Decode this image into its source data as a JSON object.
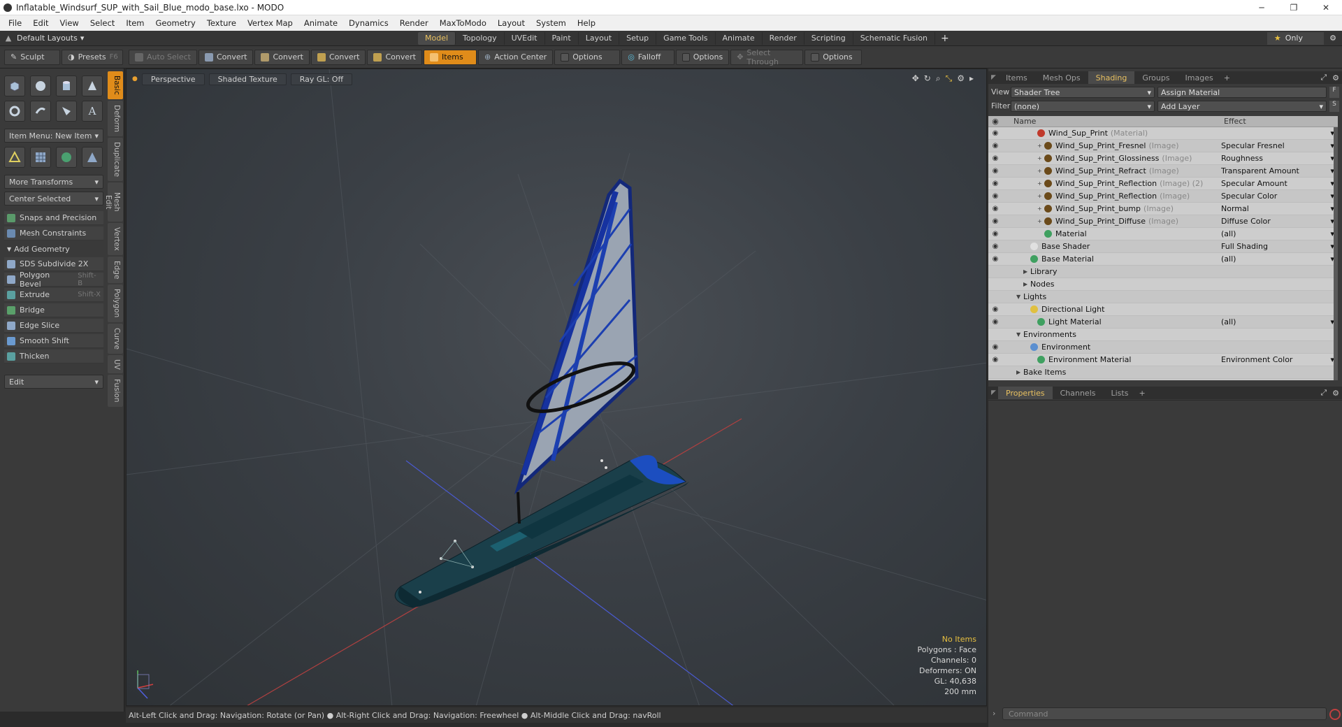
{
  "window": {
    "title": "Inflatable_Windsurf_SUP_with_Sail_Blue_modo_base.lxo - MODO"
  },
  "menu": [
    "File",
    "Edit",
    "View",
    "Select",
    "Item",
    "Geometry",
    "Texture",
    "Vertex Map",
    "Animate",
    "Dynamics",
    "Render",
    "MaxToModo",
    "Layout",
    "System",
    "Help"
  ],
  "layouts": {
    "preset": "Default Layouts",
    "tabs": [
      "Model",
      "Topology",
      "UVEdit",
      "Paint",
      "Layout",
      "Setup",
      "Game Tools",
      "Animate",
      "Render",
      "Scripting",
      "Schematic Fusion"
    ],
    "active": "Model",
    "only_label": "Only"
  },
  "toolbar": {
    "sculpt": "Sculpt",
    "presets": "Presets",
    "presets_key": "F6",
    "auto_select": "Auto Select",
    "convert1": "Convert",
    "convert2": "Convert",
    "convert3": "Convert",
    "convert4": "Convert",
    "items": "Items",
    "action_center": "Action Center",
    "options1": "Options",
    "falloff": "Falloff",
    "options2": "Options",
    "select_through": "Select Through",
    "options3": "Options"
  },
  "left": {
    "item_menu": "Item Menu: New Item",
    "more_transforms": "More Transforms",
    "center_selected": "Center Selected",
    "snaps": "Snaps and Precision",
    "mesh_constraints": "Mesh Constraints",
    "add_geometry": "Add Geometry",
    "tools": [
      {
        "label": "SDS Subdivide 2X",
        "key": ""
      },
      {
        "label": "Polygon Bevel",
        "key": "Shift-B"
      },
      {
        "label": "Extrude",
        "key": "Shift-X"
      },
      {
        "label": "Bridge",
        "key": ""
      },
      {
        "label": "Edge Slice",
        "key": ""
      },
      {
        "label": "Smooth Shift",
        "key": ""
      },
      {
        "label": "Thicken",
        "key": ""
      }
    ],
    "edit": "Edit",
    "vtabs": [
      "Basic",
      "Deform",
      "Duplicate",
      "Mesh Edit",
      "Vertex",
      "Edge",
      "Polygon",
      "Curve",
      "UV",
      "Fusion"
    ]
  },
  "viewport": {
    "perspective": "Perspective",
    "shading": "Shaded Texture",
    "raygl": "Ray GL: Off",
    "info": {
      "items": "No Items",
      "polygons": "Polygons : Face",
      "channels": "Channels: 0",
      "deformers": "Deformers: ON",
      "gl": "GL: 40,638",
      "scale": "200 mm"
    }
  },
  "status": "Alt-Left Click and Drag: Navigation: Rotate (or Pan) ●  Alt-Right Click and Drag: Navigation: Freewheel ●  Alt-Middle Click and Drag: navRoll",
  "right": {
    "tabs": [
      "Items",
      "Mesh Ops",
      "Shading",
      "Groups",
      "Images"
    ],
    "active_tab": "Shading",
    "view_label": "View",
    "view_value": "Shader Tree",
    "assign_material": "Assign Material",
    "filter_label": "Filter",
    "filter_value": "(none)",
    "add_layer": "Add Layer",
    "col_name": "Name",
    "col_effect": "Effect",
    "rows": [
      {
        "name": "Wind_Sup_Print",
        "type": "(Material)",
        "effect": "",
        "indent": 4,
        "ball": "#c0392b"
      },
      {
        "name": "Wind_Sup_Print_Fresnel",
        "type": "(Image)",
        "effect": "Specular Fresnel",
        "indent": 5,
        "ball": "#6b4a1a"
      },
      {
        "name": "Wind_Sup_Print_Glossiness",
        "type": "(Image)",
        "effect": "Roughness",
        "indent": 5,
        "ball": "#6b4a1a"
      },
      {
        "name": "Wind_Sup_Print_Refract",
        "type": "(Image)",
        "effect": "Transparent Amount",
        "indent": 5,
        "ball": "#6b4a1a"
      },
      {
        "name": "Wind_Sup_Print_Reflection",
        "type": "(Image) (2)",
        "effect": "Specular Amount",
        "indent": 5,
        "ball": "#6b4a1a"
      },
      {
        "name": "Wind_Sup_Print_Reflection",
        "type": "(Image)",
        "effect": "Specular Color",
        "indent": 5,
        "ball": "#6b4a1a"
      },
      {
        "name": "Wind_Sup_Print_bump",
        "type": "(Image)",
        "effect": "Normal",
        "indent": 5,
        "ball": "#6b4a1a"
      },
      {
        "name": "Wind_Sup_Print_Diffuse",
        "type": "(Image)",
        "effect": "Diffuse Color",
        "indent": 5,
        "ball": "#6b4a1a"
      },
      {
        "name": "Material",
        "type": "",
        "effect": "(all)",
        "indent": 5,
        "ball": "#3fa060"
      },
      {
        "name": "Base Shader",
        "type": "",
        "effect": "Full Shading",
        "indent": 3,
        "ball": "#e0e0e0"
      },
      {
        "name": "Base Material",
        "type": "",
        "effect": "(all)",
        "indent": 3,
        "ball": "#3fa060"
      },
      {
        "name": "Library",
        "type": "",
        "effect": "",
        "indent": 3,
        "ball": ""
      },
      {
        "name": "Nodes",
        "type": "",
        "effect": "",
        "indent": 3,
        "ball": ""
      },
      {
        "name": "Lights",
        "type": "",
        "effect": "",
        "indent": 2,
        "ball": ""
      },
      {
        "name": "Directional Light",
        "type": "",
        "effect": "",
        "indent": 3,
        "ball": "#e0c040"
      },
      {
        "name": "Light Material",
        "type": "",
        "effect": "(all)",
        "indent": 4,
        "ball": "#3fa060"
      },
      {
        "name": "Environments",
        "type": "",
        "effect": "",
        "indent": 2,
        "ball": ""
      },
      {
        "name": "Environment",
        "type": "",
        "effect": "",
        "indent": 3,
        "ball": "#5b8fd0"
      },
      {
        "name": "Environment Material",
        "type": "",
        "effect": "Environment Color",
        "indent": 4,
        "ball": "#3fa060"
      },
      {
        "name": "Bake Items",
        "type": "",
        "effect": "",
        "indent": 2,
        "ball": ""
      }
    ],
    "props_tabs": [
      "Properties",
      "Channels",
      "Lists"
    ],
    "props_active": "Properties",
    "command_placeholder": "Command"
  }
}
